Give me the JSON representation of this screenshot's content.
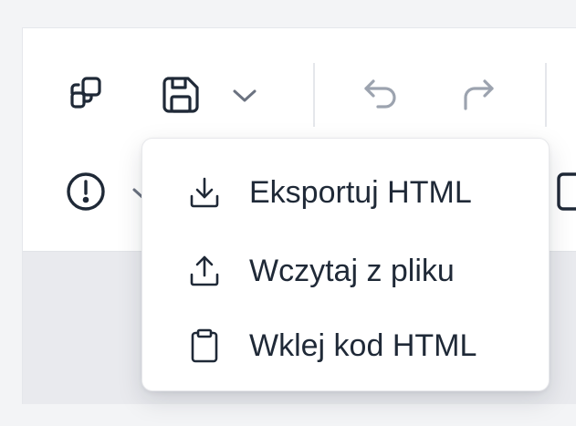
{
  "toolbar": {
    "icons": {
      "copy": "copy-icon",
      "save": "save-icon",
      "save_dropdown": "chevron-down-icon",
      "undo": "undo-icon",
      "redo": "redo-icon",
      "warning": "alert-circle-icon",
      "device": "device-icon"
    }
  },
  "menu": {
    "items": [
      {
        "label": "Eksportuj HTML",
        "icon": "download-icon"
      },
      {
        "label": "Wczytaj z pliku",
        "icon": "upload-icon"
      },
      {
        "label": "Wklej kod HTML",
        "icon": "clipboard-icon"
      }
    ]
  },
  "colors": {
    "icon_active": "#1f2937",
    "icon_disabled": "#9ca3af",
    "text": "#1f2937",
    "workspace": "#e9eaee"
  }
}
